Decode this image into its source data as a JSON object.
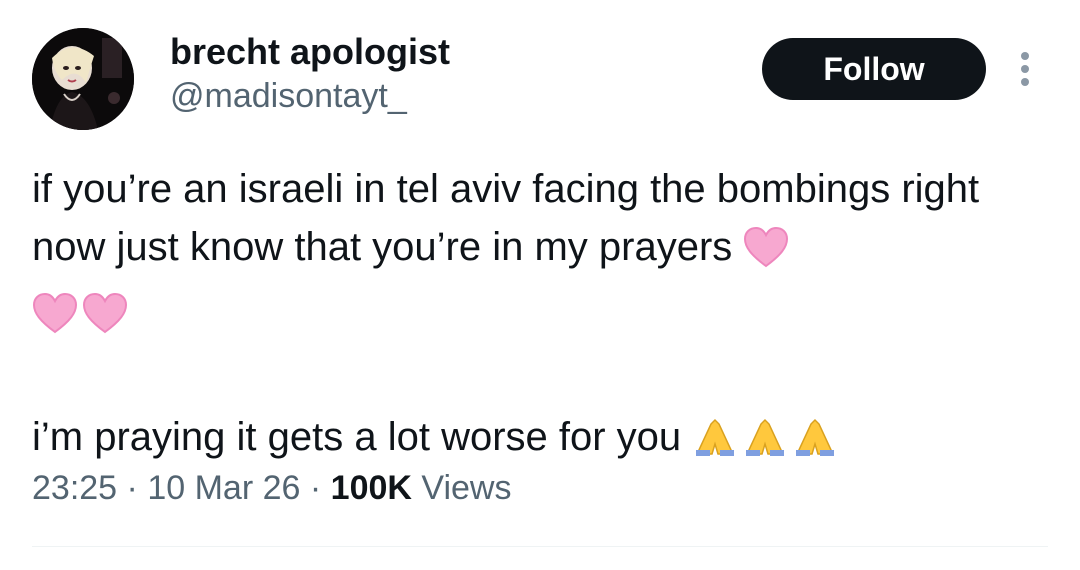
{
  "author": {
    "display_name": "brecht apologist",
    "handle": "@madisontayt_"
  },
  "actions": {
    "follow_label": "Follow",
    "more_icon": "more-vertical-icon"
  },
  "tweet": {
    "text_line_1": "if you’re an israeli in tel aviv facing the bombings right now just know that you’re in my prayers",
    "text_line_2": "i’m praying it gets a lot worse for you",
    "emoji_hearts": [
      "pink-heart-icon",
      "pink-heart-icon",
      "pink-heart-icon"
    ],
    "emoji_prayers": [
      "folded-hands-icon",
      "folded-hands-icon",
      "folded-hands-icon"
    ]
  },
  "meta": {
    "time": "23:25",
    "separator": "·",
    "date": "10 Mar 26",
    "views_count": "100K",
    "views_label": "Views"
  },
  "colors": {
    "text_primary": "#0f1419",
    "text_secondary": "#536471",
    "follow_bg": "#0f1419",
    "follow_text": "#ffffff",
    "heart": "#f7a8d0",
    "prayer": "#ffc83d"
  }
}
